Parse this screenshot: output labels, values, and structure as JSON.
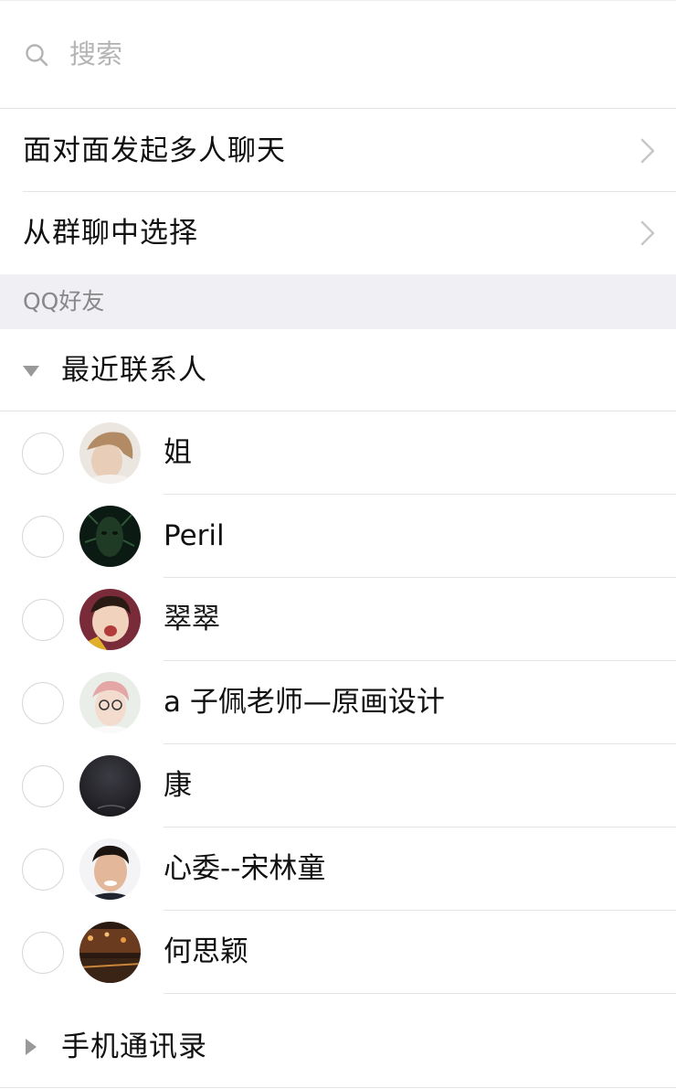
{
  "search": {
    "placeholder": "搜索",
    "icon": "search-icon"
  },
  "menu": [
    {
      "label": "面对面发起多人聊天",
      "icon": "chevron-right-icon"
    },
    {
      "label": "从群聊中选择",
      "icon": "chevron-right-icon"
    }
  ],
  "section": {
    "label": "QQ好友"
  },
  "groups": {
    "recent": {
      "label": "最近联系人",
      "expanded": true
    },
    "phone": {
      "label": "手机通讯录",
      "expanded": false
    }
  },
  "friends": [
    {
      "name": "姐",
      "selected": false
    },
    {
      "name": "Peril",
      "selected": false
    },
    {
      "name": "翠翠",
      "selected": false
    },
    {
      "name": "a 子佩老师—原画设计",
      "selected": false
    },
    {
      "name": "康",
      "selected": false
    },
    {
      "name": "心委--宋林童",
      "selected": false
    },
    {
      "name": "何思颖",
      "selected": false
    }
  ],
  "colors": {
    "background": "#ffffff",
    "section_bg": "#efeff4",
    "separator": "#e4e4e4",
    "muted_text": "#888888"
  }
}
